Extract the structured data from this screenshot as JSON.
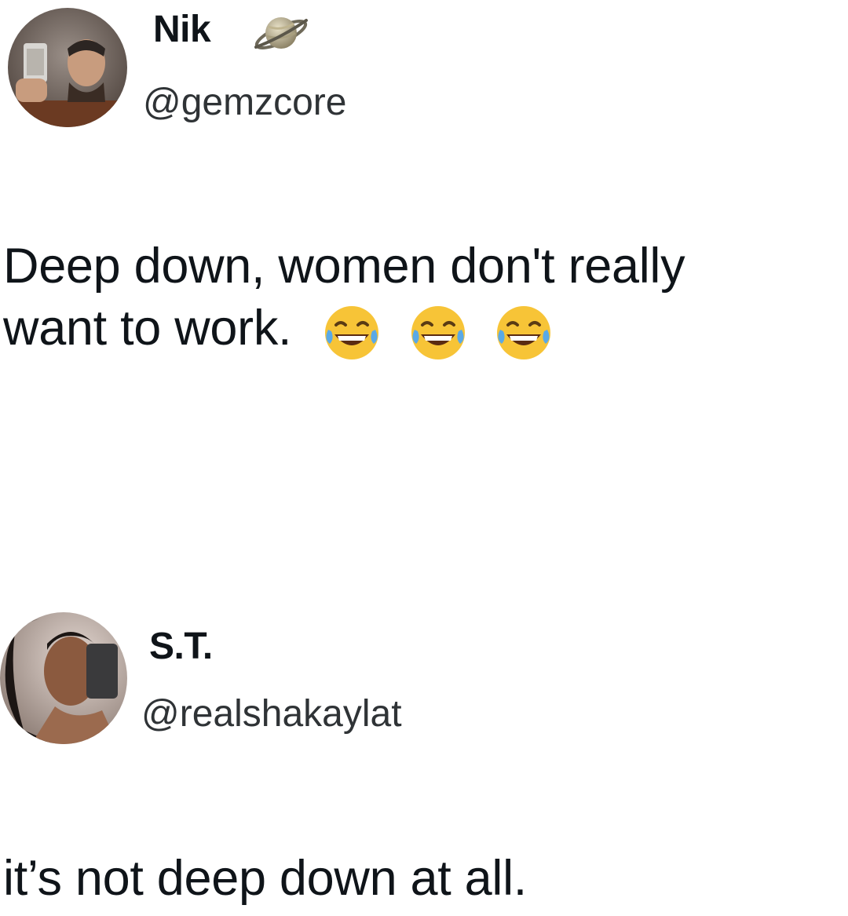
{
  "tweets": [
    {
      "display_name": "Nik",
      "handle": "@gemzcore",
      "badge_icon": "ringed-planet-icon",
      "text_line_1": "Deep down, women don't really",
      "text_line_2": "want to work.",
      "emojis": [
        "face-with-tears-of-joy-icon",
        "face-with-tears-of-joy-icon",
        "face-with-tears-of-joy-icon"
      ]
    },
    {
      "display_name": "S.T.",
      "handle": "@realshakaylat",
      "text_line_1": "it’s not deep down at all."
    }
  ],
  "colors": {
    "background": "#ffffff",
    "text": "#0f1419",
    "handle": "#2f3336",
    "emoji_face": "#f7c437",
    "emoji_tears": "#5aa9e6"
  }
}
